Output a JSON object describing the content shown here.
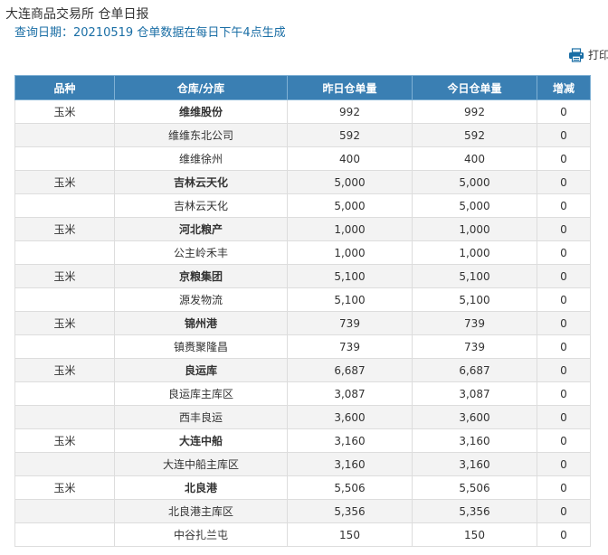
{
  "header": {
    "site_title": "大连商品交易所 仓单日报",
    "query_label": "查询日期：",
    "query_date": "20210519",
    "query_note": "仓单数据在每日下午4点生成"
  },
  "toolbar": {
    "print_label": "打印",
    "print_icon": "printer-icon"
  },
  "colors": {
    "header_bg": "#3a7fb3",
    "link_blue": "#1a6ea5",
    "stripe": "#f3f3f3"
  },
  "table": {
    "columns": [
      "品种",
      "仓库/分库",
      "昨日仓单量",
      "今日仓单量",
      "增减"
    ],
    "rows": [
      {
        "variety": "玉米",
        "warehouse": "维维股份",
        "yesterday": "992",
        "today": "992",
        "change": "0",
        "is_group": true
      },
      {
        "variety": "",
        "warehouse": "维维东北公司",
        "yesterday": "592",
        "today": "592",
        "change": "0",
        "is_group": false
      },
      {
        "variety": "",
        "warehouse": "维维徐州",
        "yesterday": "400",
        "today": "400",
        "change": "0",
        "is_group": false
      },
      {
        "variety": "玉米",
        "warehouse": "吉林云天化",
        "yesterday": "5,000",
        "today": "5,000",
        "change": "0",
        "is_group": true
      },
      {
        "variety": "",
        "warehouse": "吉林云天化",
        "yesterday": "5,000",
        "today": "5,000",
        "change": "0",
        "is_group": false
      },
      {
        "variety": "玉米",
        "warehouse": "河北粮产",
        "yesterday": "1,000",
        "today": "1,000",
        "change": "0",
        "is_group": true
      },
      {
        "variety": "",
        "warehouse": "公主岭禾丰",
        "yesterday": "1,000",
        "today": "1,000",
        "change": "0",
        "is_group": false
      },
      {
        "variety": "玉米",
        "warehouse": "京粮集团",
        "yesterday": "5,100",
        "today": "5,100",
        "change": "0",
        "is_group": true
      },
      {
        "variety": "",
        "warehouse": "源发物流",
        "yesterday": "5,100",
        "today": "5,100",
        "change": "0",
        "is_group": false
      },
      {
        "variety": "玉米",
        "warehouse": "锦州港",
        "yesterday": "739",
        "today": "739",
        "change": "0",
        "is_group": true
      },
      {
        "variety": "",
        "warehouse": "镇赉聚隆昌",
        "yesterday": "739",
        "today": "739",
        "change": "0",
        "is_group": false
      },
      {
        "variety": "玉米",
        "warehouse": "良运库",
        "yesterday": "6,687",
        "today": "6,687",
        "change": "0",
        "is_group": true
      },
      {
        "variety": "",
        "warehouse": "良运库主库区",
        "yesterday": "3,087",
        "today": "3,087",
        "change": "0",
        "is_group": false
      },
      {
        "variety": "",
        "warehouse": "西丰良运",
        "yesterday": "3,600",
        "today": "3,600",
        "change": "0",
        "is_group": false
      },
      {
        "variety": "玉米",
        "warehouse": "大连中船",
        "yesterday": "3,160",
        "today": "3,160",
        "change": "0",
        "is_group": true
      },
      {
        "variety": "",
        "warehouse": "大连中船主库区",
        "yesterday": "3,160",
        "today": "3,160",
        "change": "0",
        "is_group": false
      },
      {
        "variety": "玉米",
        "warehouse": "北良港",
        "yesterday": "5,506",
        "today": "5,506",
        "change": "0",
        "is_group": true
      },
      {
        "variety": "",
        "warehouse": "北良港主库区",
        "yesterday": "5,356",
        "today": "5,356",
        "change": "0",
        "is_group": false
      },
      {
        "variety": "",
        "warehouse": "中谷扎兰屯",
        "yesterday": "150",
        "today": "150",
        "change": "0",
        "is_group": false
      }
    ]
  }
}
